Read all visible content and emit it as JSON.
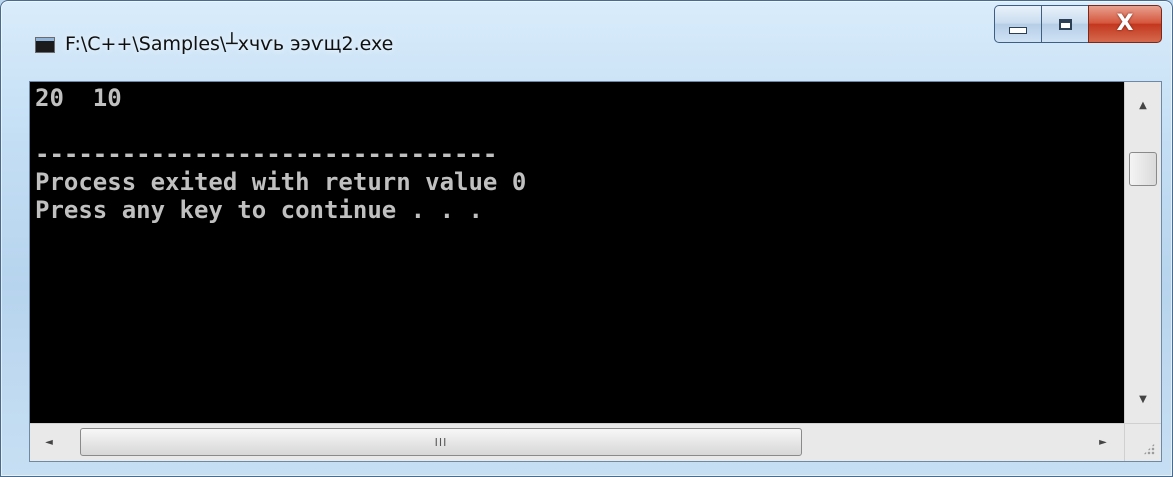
{
  "window": {
    "title": "F:\\C++\\Samples\\┴хчѵь ээѵщ2.exe"
  },
  "caption_buttons": {
    "minimize_icon": "minimize-icon",
    "maximize_icon": "maximize-icon",
    "close_glyph": "X"
  },
  "console": {
    "lines": [
      "20  10",
      "",
      "--------------------------------",
      "Process exited with return value 0",
      "Press any key to continue . . ."
    ]
  },
  "scrollbars": {
    "up_arrow": "▲",
    "down_arrow": "▼",
    "left_arrow": "◄",
    "right_arrow": "►",
    "h_thumb_grip": "III"
  },
  "colors": {
    "console_bg": "#000000",
    "console_text": "#c0c0c0",
    "close_button": "#c2371e",
    "frame": "#b9d6ee"
  }
}
